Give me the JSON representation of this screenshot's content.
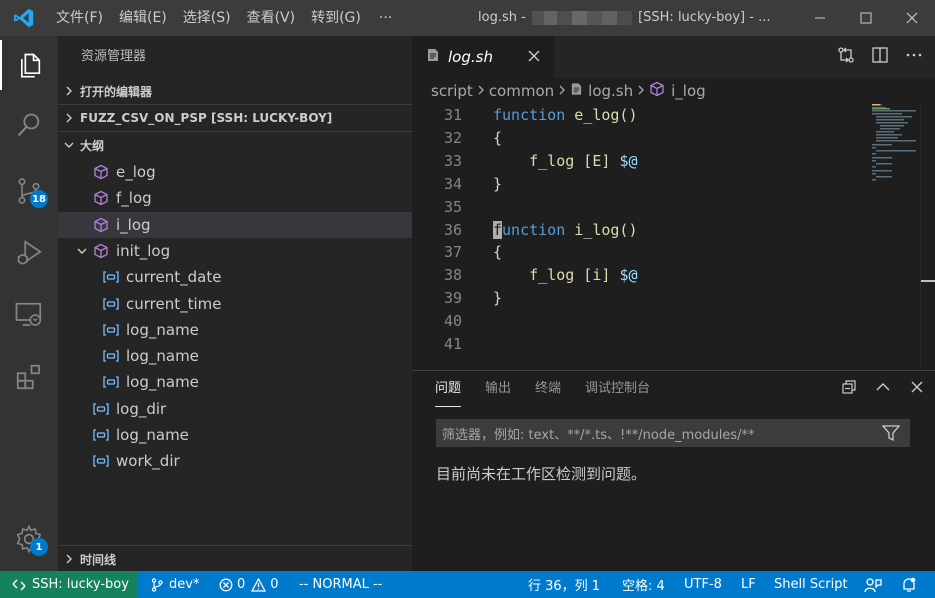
{
  "titlebar": {
    "menu": [
      "文件(F)",
      "编辑(E)",
      "选择(S)",
      "查看(V)",
      "转到(G)"
    ],
    "more": "···",
    "title_prefix": "log.sh -",
    "title_suffix": "[SSH: lucky-boy] - ..."
  },
  "activity": {
    "scm_badge": "18",
    "settings_badge": "1"
  },
  "sidebar": {
    "title": "资源管理器",
    "open_editors": "打开的编辑器",
    "folder": "FUZZ_CSV_ON_PSP [SSH: LUCKY-BOY]",
    "outline": "大纲",
    "outline_items": [
      {
        "label": "e_log",
        "kind": "function"
      },
      {
        "label": "f_log",
        "kind": "function"
      },
      {
        "label": "i_log",
        "kind": "function",
        "selected": true
      },
      {
        "label": "init_log",
        "kind": "function",
        "expanded": true
      },
      {
        "label": "current_date",
        "kind": "variable"
      },
      {
        "label": "current_time",
        "kind": "variable"
      },
      {
        "label": "log_name",
        "kind": "variable"
      },
      {
        "label": "log_name",
        "kind": "variable"
      },
      {
        "label": "log_name",
        "kind": "variable"
      },
      {
        "label": "log_dir",
        "kind": "variable"
      },
      {
        "label": "log_name",
        "kind": "variable"
      },
      {
        "label": "work_dir",
        "kind": "variable"
      }
    ],
    "timeline": "时间线"
  },
  "editor": {
    "tab": "log.sh",
    "breadcrumb": [
      "script",
      "common",
      "log.sh",
      "i_log"
    ],
    "lines": [
      {
        "n": "31",
        "kw": "function",
        "fn": "e_log()"
      },
      {
        "n": "32",
        "text": "{"
      },
      {
        "n": "33",
        "indent": "    ",
        "cmd": "f_log [E] ",
        "var": "$@"
      },
      {
        "n": "34",
        "text": "}"
      },
      {
        "n": "35",
        "text": ""
      },
      {
        "n": "36",
        "kw_first": "f",
        "kw_rest": "unction",
        "fn": "i_log()"
      },
      {
        "n": "37",
        "text": "{"
      },
      {
        "n": "38",
        "indent": "    ",
        "cmd": "f_log [i] ",
        "var": "$@"
      },
      {
        "n": "39",
        "text": "}"
      },
      {
        "n": "40",
        "text": ""
      },
      {
        "n": "41",
        "text": ""
      }
    ]
  },
  "panel": {
    "tabs": [
      "问题",
      "输出",
      "终端",
      "调试控制台"
    ],
    "filter_placeholder": "筛选器，例如: text、**/*.ts、!**/node_modules/**",
    "message": "目前尚未在工作区检测到问题。"
  },
  "status": {
    "remote": "SSH: lucky-boy",
    "branch": "dev*",
    "errors": "0",
    "warnings": "0",
    "mode": "-- NORMAL --",
    "position": "行 36，列 1",
    "spaces": "空格: 4",
    "encoding": "UTF-8",
    "eol": "LF",
    "language": "Shell Script"
  },
  "colors": {
    "accent": "#007acc",
    "remote": "#16825d",
    "function_icon": "#b180d7",
    "variable_icon": "#75beff"
  }
}
